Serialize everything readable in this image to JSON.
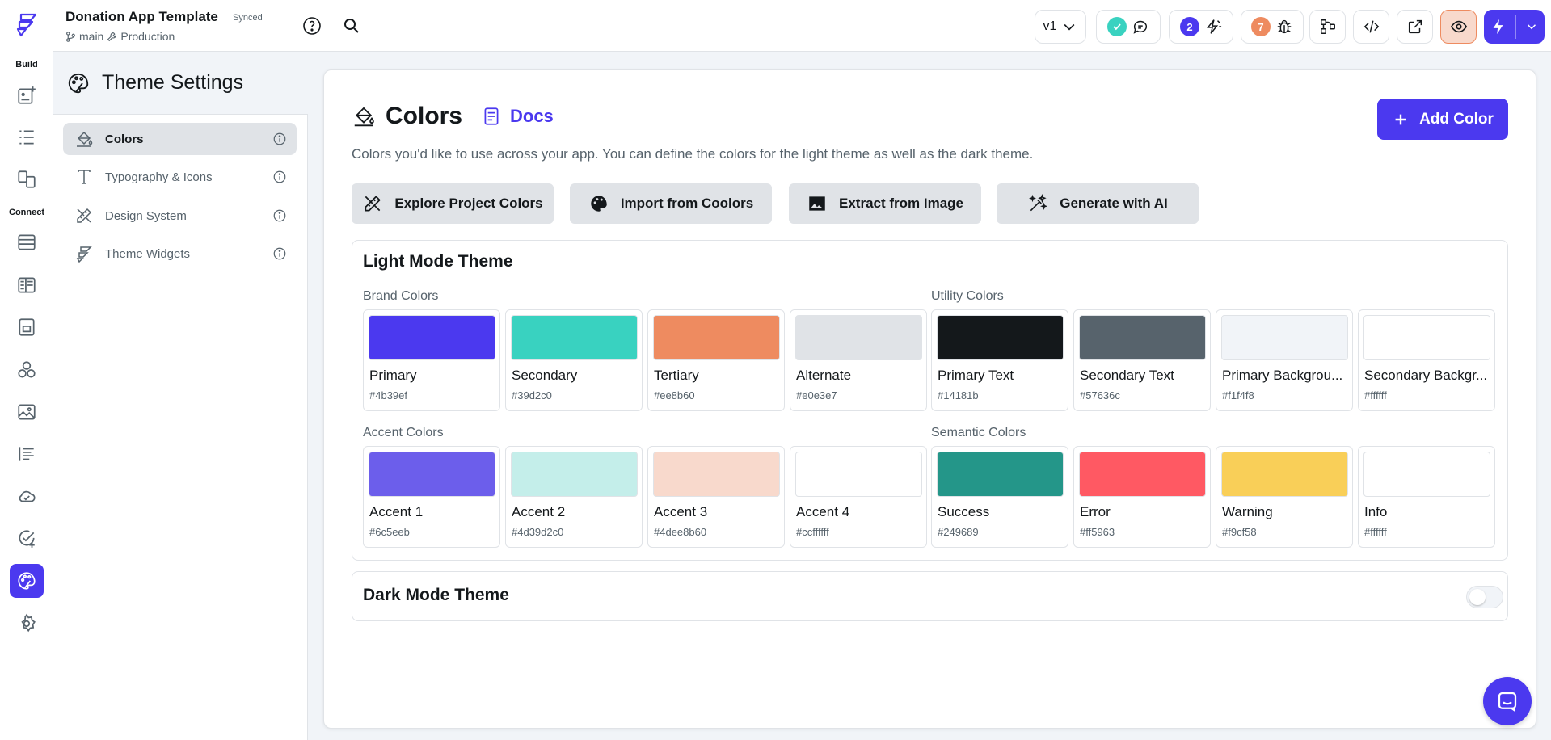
{
  "app": {
    "project_title": "Donation App Template",
    "sync_status": "Synced",
    "branch": "main",
    "environment": "Production",
    "version": "v1",
    "comment_badge": "2",
    "issue_badge": "7",
    "brand_color": "#4b39ef"
  },
  "rail": {
    "build_label": "Build",
    "connect_label": "Connect",
    "build_icons": [
      "add-page-icon",
      "widget-tree-icon",
      "storyboard-icon"
    ],
    "connect_icons": [
      "database-icon",
      "app-state-icon",
      "media-assets-icon",
      "custom-code-icon",
      "images-icon",
      "api-calls-icon",
      "cloud-functions-icon",
      "tests-icon",
      "theme-settings-icon",
      "settings-icon"
    ]
  },
  "sidebar": {
    "title": "Theme Settings",
    "items": [
      {
        "label": "Colors",
        "icon": "paint-bucket-icon"
      },
      {
        "label": "Typography & Icons",
        "icon": "text-icon"
      },
      {
        "label": "Design System",
        "icon": "design-ruler-icon"
      },
      {
        "label": "Theme Widgets",
        "icon": "palette-widget-icon"
      }
    ]
  },
  "main": {
    "title": "Colors",
    "docs_label": "Docs",
    "description": "Colors you'd like to use across your app. You can define the colors for the light theme as well as the dark theme.",
    "add_color_label": "Add Color",
    "actions": [
      {
        "label": "Explore Project Colors",
        "icon": "explore-colors-icon"
      },
      {
        "label": "Import from Coolors",
        "icon": "palette-icon"
      },
      {
        "label": "Extract from Image",
        "icon": "image-icon"
      },
      {
        "label": "Generate with AI",
        "icon": "ai-sparkle-icon"
      }
    ],
    "light_mode_title": "Light Mode Theme",
    "dark_mode_title": "Dark Mode Theme",
    "dark_mode_enabled": false,
    "groups": {
      "brand": {
        "label": "Brand Colors",
        "colors": [
          {
            "name": "Primary",
            "hex": "#4b39ef"
          },
          {
            "name": "Secondary",
            "hex": "#39d2c0"
          },
          {
            "name": "Tertiary",
            "hex": "#ee8b60"
          },
          {
            "name": "Alternate",
            "hex": "#e0e3e7"
          }
        ]
      },
      "utility": {
        "label": "Utility Colors",
        "colors": [
          {
            "name": "Primary Text",
            "hex": "#14181b"
          },
          {
            "name": "Secondary Text",
            "hex": "#57636c"
          },
          {
            "name": "Primary Backgrou...",
            "hex": "#f1f4f8"
          },
          {
            "name": "Secondary Backgr...",
            "hex": "#ffffff"
          }
        ]
      },
      "accent": {
        "label": "Accent Colors",
        "colors": [
          {
            "name": "Accent 1",
            "hex": "#6c5eeb",
            "swatch": "#6c5eeb"
          },
          {
            "name": "Accent 2",
            "hex": "#4d39d2c0",
            "swatch": "#c4eeea"
          },
          {
            "name": "Accent 3",
            "hex": "#4dee8b60",
            "swatch": "#f8d9cc"
          },
          {
            "name": "Accent 4",
            "hex": "#ccffffff",
            "swatch": "#ffffff"
          }
        ]
      },
      "semantic": {
        "label": "Semantic Colors",
        "colors": [
          {
            "name": "Success",
            "hex": "#249689"
          },
          {
            "name": "Error",
            "hex": "#ff5963"
          },
          {
            "name": "Warning",
            "hex": "#f9cf58"
          },
          {
            "name": "Info",
            "hex": "#ffffff"
          }
        ]
      }
    }
  }
}
